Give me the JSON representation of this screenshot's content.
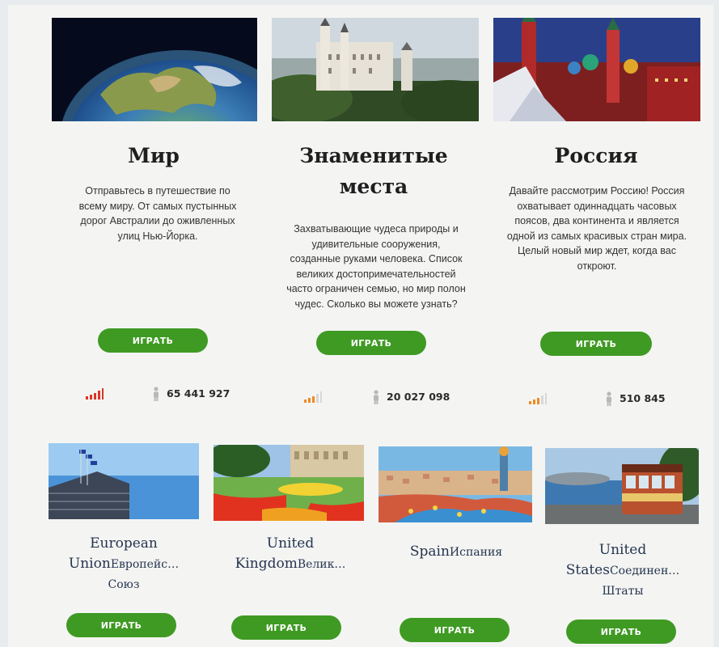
{
  "featured": [
    {
      "title": "Мир",
      "description": "Отправьтесь в путешествие по всему миру. От самых пустынных дорог Австралии до оживленных улиц Нью-Йорка.",
      "button": "ИГРАТЬ",
      "players": "65 441 927",
      "difficulty_color": "#d9352a",
      "image_icon": "earth-image"
    },
    {
      "title": "Знаменитые места",
      "description": "Захватывающие чудеса природы и удивительные сооружения, созданные руками человека. Список великих достопримечательностей часто ограничен семью, но мир полон чудес. Сколько вы можете узнать?",
      "button": "ИГРАТЬ",
      "players": "20 027 098",
      "difficulty_color": "#f08a24",
      "image_icon": "castle-image"
    },
    {
      "title": "Россия",
      "description": "Давайте рассмотрим Россию! Россия охватывает одиннадцать часовых поясов, два континента и является одной из самых красивых стран мира. Целый новый мир ждет, когда вас откроют.",
      "button": "ИГРАТЬ",
      "players": "510 845",
      "difficulty_color": "#f08a24",
      "image_icon": "kremlin-image"
    }
  ],
  "regions": [
    {
      "title_en": "European",
      "title_en2": "Union",
      "title_ru": "Европейс…",
      "title_ru2": "Союз",
      "button": "ИГРАТЬ",
      "image_icon": "eu-building-image"
    },
    {
      "title_en": "United",
      "title_en2": "Kingdom",
      "title_ru": "Велик…",
      "title_ru2": "",
      "button": "ИГРАТЬ",
      "image_icon": "uk-garden-image"
    },
    {
      "title_en": "",
      "title_en2": "Spain",
      "title_ru": "Испания",
      "title_ru2": "",
      "button": "ИГРАТЬ",
      "image_icon": "spain-park-image"
    },
    {
      "title_en": "United",
      "title_en2": "States",
      "title_ru": "Соединен…",
      "title_ru2": "Штаты",
      "button": "ИГРАТЬ",
      "image_icon": "usa-cablecar-image"
    }
  ],
  "colors": {
    "button": "#3f9a23",
    "signal_inactive": "#d8d8d8",
    "person_icon": "#b8b8b8"
  }
}
